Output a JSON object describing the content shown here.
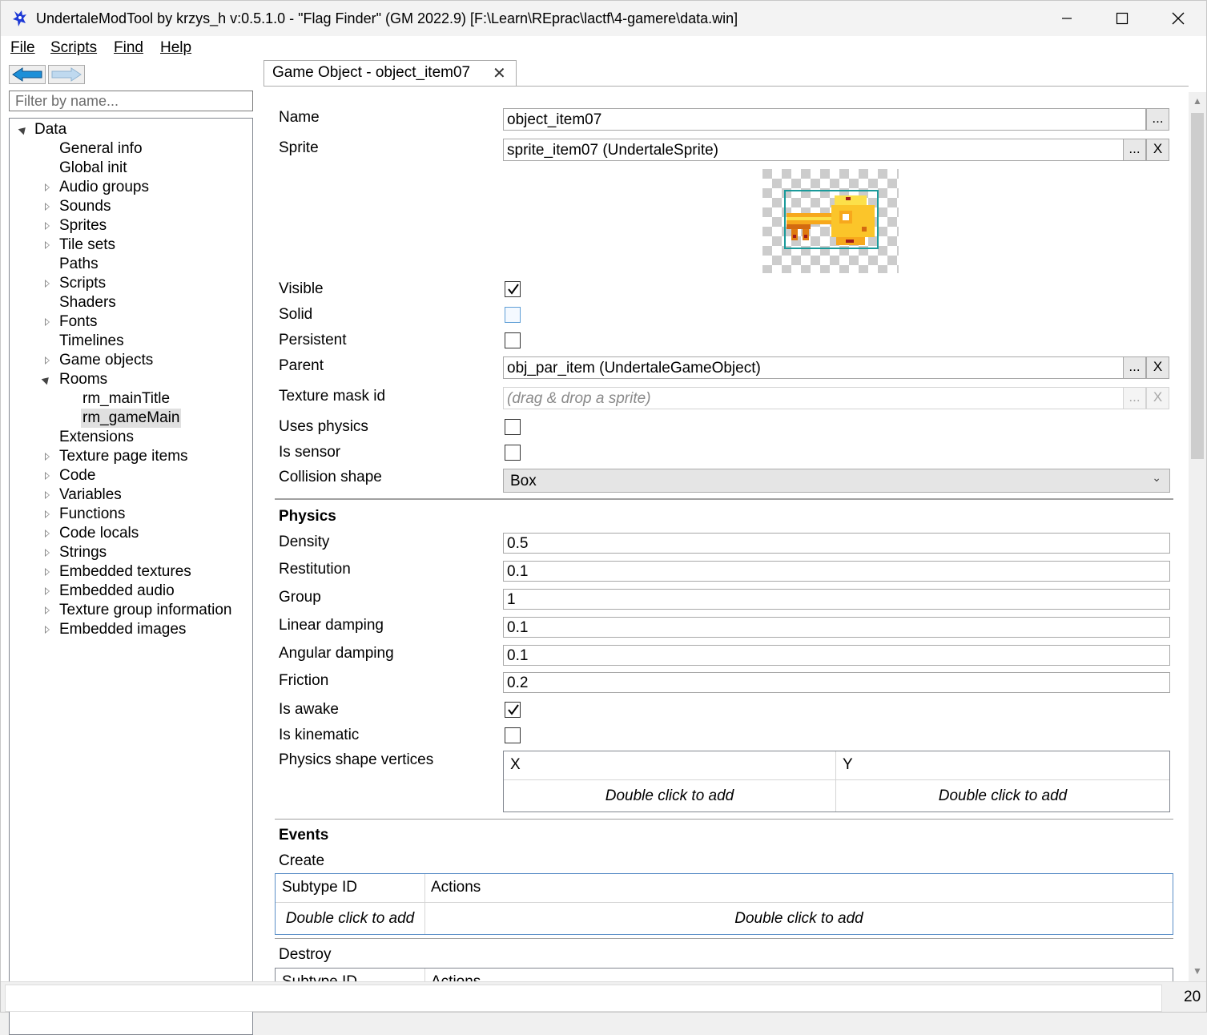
{
  "window": {
    "title": "UndertaleModTool by krzys_h v:0.5.1.0 - \"Flag Finder\" (GM 2022.9) [F:\\Learn\\REprac\\lactf\\4-gamere\\data.win]"
  },
  "menu": {
    "file": "File",
    "scripts": "Scripts",
    "find": "Find",
    "help": "Help"
  },
  "sidebar": {
    "filter_placeholder": "Filter by name...",
    "root": "Data",
    "items": [
      {
        "label": "General info",
        "expander": "none"
      },
      {
        "label": "Global init",
        "expander": "none"
      },
      {
        "label": "Audio groups",
        "expander": "closed"
      },
      {
        "label": "Sounds",
        "expander": "closed"
      },
      {
        "label": "Sprites",
        "expander": "closed"
      },
      {
        "label": "Tile sets",
        "expander": "closed"
      },
      {
        "label": "Paths",
        "expander": "none"
      },
      {
        "label": "Scripts",
        "expander": "closed"
      },
      {
        "label": "Shaders",
        "expander": "none"
      },
      {
        "label": "Fonts",
        "expander": "closed"
      },
      {
        "label": "Timelines",
        "expander": "none"
      },
      {
        "label": "Game objects",
        "expander": "closed"
      },
      {
        "label": "Rooms",
        "expander": "open"
      },
      {
        "label": "rm_mainTitle",
        "expander": "child"
      },
      {
        "label": "rm_gameMain",
        "expander": "child-selected"
      },
      {
        "label": "Extensions",
        "expander": "none"
      },
      {
        "label": "Texture page items",
        "expander": "closed"
      },
      {
        "label": "Code",
        "expander": "closed"
      },
      {
        "label": "Variables",
        "expander": "closed"
      },
      {
        "label": "Functions",
        "expander": "closed"
      },
      {
        "label": "Code locals",
        "expander": "closed"
      },
      {
        "label": "Strings",
        "expander": "closed"
      },
      {
        "label": "Embedded textures",
        "expander": "closed"
      },
      {
        "label": "Embedded audio",
        "expander": "closed"
      },
      {
        "label": "Texture group information",
        "expander": "closed"
      },
      {
        "label": "Embedded images",
        "expander": "closed"
      }
    ]
  },
  "tab": {
    "label": "Game Object - object_item07",
    "close": "✕"
  },
  "form": {
    "name_label": "Name",
    "name_value": "object_item07",
    "sprite_label": "Sprite",
    "sprite_value": "sprite_item07 (UndertaleSprite)",
    "visible_label": "Visible",
    "visible_checked": true,
    "solid_label": "Solid",
    "solid_checked": false,
    "persistent_label": "Persistent",
    "persistent_checked": false,
    "parent_label": "Parent",
    "parent_value": "obj_par_item (UndertaleGameObject)",
    "texture_mask_label": "Texture mask id",
    "texture_mask_placeholder": "(drag & drop a sprite)",
    "uses_physics_label": "Uses physics",
    "uses_physics_checked": false,
    "is_sensor_label": "Is sensor",
    "is_sensor_checked": false,
    "collision_shape_label": "Collision shape",
    "collision_shape_value": "Box",
    "ellipsis": "...",
    "clear": "X"
  },
  "physics": {
    "heading": "Physics",
    "density_label": "Density",
    "density_value": "0.5",
    "restitution_label": "Restitution",
    "restitution_value": "0.1",
    "group_label": "Group",
    "group_value": "1",
    "linear_damping_label": "Linear damping",
    "linear_damping_value": "0.1",
    "angular_damping_label": "Angular damping",
    "angular_damping_value": "0.1",
    "friction_label": "Friction",
    "friction_value": "0.2",
    "is_awake_label": "Is awake",
    "is_awake_checked": true,
    "is_kinematic_label": "Is kinematic",
    "is_kinematic_checked": false,
    "vertices_label": "Physics shape vertices",
    "vertices_columns": [
      "X",
      "Y"
    ],
    "vertices_add_hint": "Double click to add"
  },
  "events": {
    "heading": "Events",
    "create_label": "Create",
    "destroy_label": "Destroy",
    "columns": [
      "Subtype ID",
      "Actions"
    ],
    "add_hint": "Double click to add"
  },
  "status": {
    "value": "20"
  },
  "colors": {
    "accent": "#0078d7",
    "selection": "#e0e0e0",
    "sprite_border": "#1a9a9a"
  }
}
